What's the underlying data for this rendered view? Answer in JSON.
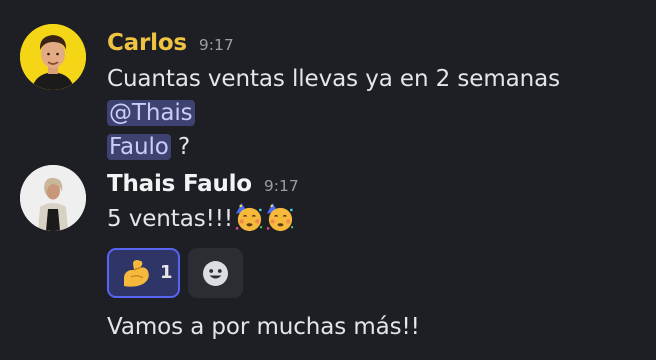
{
  "messages": [
    {
      "author": "Carlos",
      "author_color": "#f0c443",
      "time": "9:17",
      "text_line1": "Cuantas ventas llevas ya en 2 semanas",
      "mention_line1": "@Thais",
      "mention_line2": "Faulo",
      "text_after_mention": " ?"
    },
    {
      "author": "Thais Faulo",
      "author_color": "#f2f3f5",
      "time": "9:17",
      "text": "5 ventas!!!",
      "emojis": [
        "partying-face",
        "partying-face"
      ],
      "reactions": [
        {
          "emoji": "flexed-biceps",
          "count": "1",
          "active": true
        },
        {
          "emoji": "add-reaction-smiley",
          "active": false
        }
      ],
      "followup": "Vamos a por muchas más!!"
    }
  ]
}
